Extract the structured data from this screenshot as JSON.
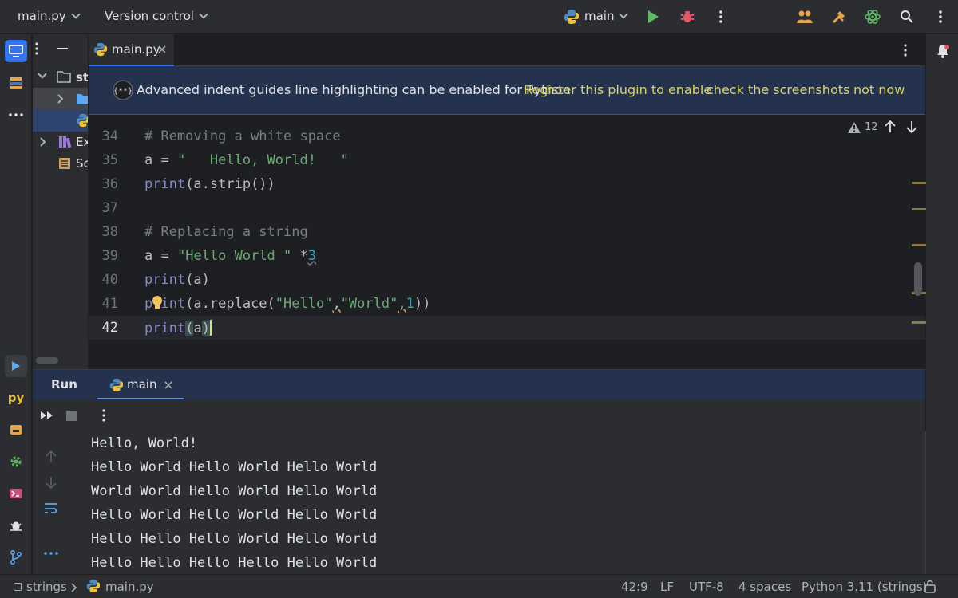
{
  "topbar": {
    "project_widget": "main.py",
    "vcs_widget": "Version control",
    "run_config": "main"
  },
  "project_panel": {
    "rows": [
      {
        "label": "st"
      },
      {
        "label": ""
      },
      {
        "label": ""
      },
      {
        "label": "Ex"
      },
      {
        "label": "Sc"
      }
    ]
  },
  "editor": {
    "tab_label": "main.py",
    "banner": {
      "message": "Advanced indent guides line highlighting can be enabled for Python",
      "register_link": "Register this plugin to enable",
      "screenshots_link": "check the screenshots",
      "dismiss_link": "not now"
    },
    "inspection_count": "12",
    "lines": [
      {
        "num": "34"
      },
      {
        "num": "35"
      },
      {
        "num": "36"
      },
      {
        "num": "37"
      },
      {
        "num": "38"
      },
      {
        "num": "39"
      },
      {
        "num": "40"
      },
      {
        "num": "41"
      },
      {
        "num": "42"
      }
    ],
    "tokens": {
      "c34": "# Removing a white space",
      "a": "a",
      "eq": " = ",
      "s35": "\"   Hello, World!   \"",
      "print": "print",
      "p36": "(a.strip())",
      "c38": "# Replacing a string",
      "s39": "\"Hello World \"",
      "mul": " *",
      "n39": "3",
      "p40": "(a)",
      "p41a": "(a.replace(",
      "s41a": "\"Hello\"",
      "comma": ",",
      "s41b": "\"World\"",
      "n41": "1",
      "p41b": "))",
      "p42a": "(",
      "p42b": "a",
      "p42c": ")"
    }
  },
  "run_panel": {
    "title": "Run",
    "tab_label": "main",
    "output": [
      "Hello, World!",
      "Hello World Hello World Hello World",
      "World World Hello World Hello World",
      "Hello World Hello World Hello World",
      "Hello Hello Hello World Hello World",
      "Hello Hello Hello Hello Hello World"
    ]
  },
  "statusbar": {
    "project": "strings",
    "file": "main.py",
    "position": "42:9",
    "line_sep": "LF",
    "encoding": "UTF-8",
    "indent": "4 spaces",
    "interpreter": "Python 3.11 (strings)"
  },
  "colors": {
    "accent": "#3574f0",
    "banner_bg": "#25324d",
    "link": "#d9d35e",
    "run_green": "#5fb865",
    "debug_red": "#e55765"
  }
}
